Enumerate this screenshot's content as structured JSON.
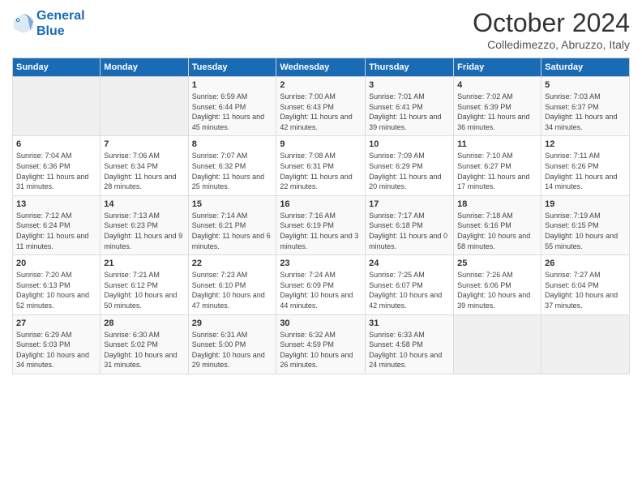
{
  "logo": {
    "line1": "General",
    "line2": "Blue"
  },
  "title": "October 2024",
  "subtitle": "Colledimezzo, Abruzzo, Italy",
  "header_days": [
    "Sunday",
    "Monday",
    "Tuesday",
    "Wednesday",
    "Thursday",
    "Friday",
    "Saturday"
  ],
  "weeks": [
    [
      {
        "day": "",
        "sunrise": "",
        "sunset": "",
        "daylight": ""
      },
      {
        "day": "",
        "sunrise": "",
        "sunset": "",
        "daylight": ""
      },
      {
        "day": "1",
        "sunrise": "Sunrise: 6:59 AM",
        "sunset": "Sunset: 6:44 PM",
        "daylight": "Daylight: 11 hours and 45 minutes."
      },
      {
        "day": "2",
        "sunrise": "Sunrise: 7:00 AM",
        "sunset": "Sunset: 6:43 PM",
        "daylight": "Daylight: 11 hours and 42 minutes."
      },
      {
        "day": "3",
        "sunrise": "Sunrise: 7:01 AM",
        "sunset": "Sunset: 6:41 PM",
        "daylight": "Daylight: 11 hours and 39 minutes."
      },
      {
        "day": "4",
        "sunrise": "Sunrise: 7:02 AM",
        "sunset": "Sunset: 6:39 PM",
        "daylight": "Daylight: 11 hours and 36 minutes."
      },
      {
        "day": "5",
        "sunrise": "Sunrise: 7:03 AM",
        "sunset": "Sunset: 6:37 PM",
        "daylight": "Daylight: 11 hours and 34 minutes."
      }
    ],
    [
      {
        "day": "6",
        "sunrise": "Sunrise: 7:04 AM",
        "sunset": "Sunset: 6:36 PM",
        "daylight": "Daylight: 11 hours and 31 minutes."
      },
      {
        "day": "7",
        "sunrise": "Sunrise: 7:06 AM",
        "sunset": "Sunset: 6:34 PM",
        "daylight": "Daylight: 11 hours and 28 minutes."
      },
      {
        "day": "8",
        "sunrise": "Sunrise: 7:07 AM",
        "sunset": "Sunset: 6:32 PM",
        "daylight": "Daylight: 11 hours and 25 minutes."
      },
      {
        "day": "9",
        "sunrise": "Sunrise: 7:08 AM",
        "sunset": "Sunset: 6:31 PM",
        "daylight": "Daylight: 11 hours and 22 minutes."
      },
      {
        "day": "10",
        "sunrise": "Sunrise: 7:09 AM",
        "sunset": "Sunset: 6:29 PM",
        "daylight": "Daylight: 11 hours and 20 minutes."
      },
      {
        "day": "11",
        "sunrise": "Sunrise: 7:10 AM",
        "sunset": "Sunset: 6:27 PM",
        "daylight": "Daylight: 11 hours and 17 minutes."
      },
      {
        "day": "12",
        "sunrise": "Sunrise: 7:11 AM",
        "sunset": "Sunset: 6:26 PM",
        "daylight": "Daylight: 11 hours and 14 minutes."
      }
    ],
    [
      {
        "day": "13",
        "sunrise": "Sunrise: 7:12 AM",
        "sunset": "Sunset: 6:24 PM",
        "daylight": "Daylight: 11 hours and 11 minutes."
      },
      {
        "day": "14",
        "sunrise": "Sunrise: 7:13 AM",
        "sunset": "Sunset: 6:23 PM",
        "daylight": "Daylight: 11 hours and 9 minutes."
      },
      {
        "day": "15",
        "sunrise": "Sunrise: 7:14 AM",
        "sunset": "Sunset: 6:21 PM",
        "daylight": "Daylight: 11 hours and 6 minutes."
      },
      {
        "day": "16",
        "sunrise": "Sunrise: 7:16 AM",
        "sunset": "Sunset: 6:19 PM",
        "daylight": "Daylight: 11 hours and 3 minutes."
      },
      {
        "day": "17",
        "sunrise": "Sunrise: 7:17 AM",
        "sunset": "Sunset: 6:18 PM",
        "daylight": "Daylight: 11 hours and 0 minutes."
      },
      {
        "day": "18",
        "sunrise": "Sunrise: 7:18 AM",
        "sunset": "Sunset: 6:16 PM",
        "daylight": "Daylight: 10 hours and 58 minutes."
      },
      {
        "day": "19",
        "sunrise": "Sunrise: 7:19 AM",
        "sunset": "Sunset: 6:15 PM",
        "daylight": "Daylight: 10 hours and 55 minutes."
      }
    ],
    [
      {
        "day": "20",
        "sunrise": "Sunrise: 7:20 AM",
        "sunset": "Sunset: 6:13 PM",
        "daylight": "Daylight: 10 hours and 52 minutes."
      },
      {
        "day": "21",
        "sunrise": "Sunrise: 7:21 AM",
        "sunset": "Sunset: 6:12 PM",
        "daylight": "Daylight: 10 hours and 50 minutes."
      },
      {
        "day": "22",
        "sunrise": "Sunrise: 7:23 AM",
        "sunset": "Sunset: 6:10 PM",
        "daylight": "Daylight: 10 hours and 47 minutes."
      },
      {
        "day": "23",
        "sunrise": "Sunrise: 7:24 AM",
        "sunset": "Sunset: 6:09 PM",
        "daylight": "Daylight: 10 hours and 44 minutes."
      },
      {
        "day": "24",
        "sunrise": "Sunrise: 7:25 AM",
        "sunset": "Sunset: 6:07 PM",
        "daylight": "Daylight: 10 hours and 42 minutes."
      },
      {
        "day": "25",
        "sunrise": "Sunrise: 7:26 AM",
        "sunset": "Sunset: 6:06 PM",
        "daylight": "Daylight: 10 hours and 39 minutes."
      },
      {
        "day": "26",
        "sunrise": "Sunrise: 7:27 AM",
        "sunset": "Sunset: 6:04 PM",
        "daylight": "Daylight: 10 hours and 37 minutes."
      }
    ],
    [
      {
        "day": "27",
        "sunrise": "Sunrise: 6:29 AM",
        "sunset": "Sunset: 5:03 PM",
        "daylight": "Daylight: 10 hours and 34 minutes."
      },
      {
        "day": "28",
        "sunrise": "Sunrise: 6:30 AM",
        "sunset": "Sunset: 5:02 PM",
        "daylight": "Daylight: 10 hours and 31 minutes."
      },
      {
        "day": "29",
        "sunrise": "Sunrise: 6:31 AM",
        "sunset": "Sunset: 5:00 PM",
        "daylight": "Daylight: 10 hours and 29 minutes."
      },
      {
        "day": "30",
        "sunrise": "Sunrise: 6:32 AM",
        "sunset": "Sunset: 4:59 PM",
        "daylight": "Daylight: 10 hours and 26 minutes."
      },
      {
        "day": "31",
        "sunrise": "Sunrise: 6:33 AM",
        "sunset": "Sunset: 4:58 PM",
        "daylight": "Daylight: 10 hours and 24 minutes."
      },
      {
        "day": "",
        "sunrise": "",
        "sunset": "",
        "daylight": ""
      },
      {
        "day": "",
        "sunrise": "",
        "sunset": "",
        "daylight": ""
      }
    ]
  ]
}
